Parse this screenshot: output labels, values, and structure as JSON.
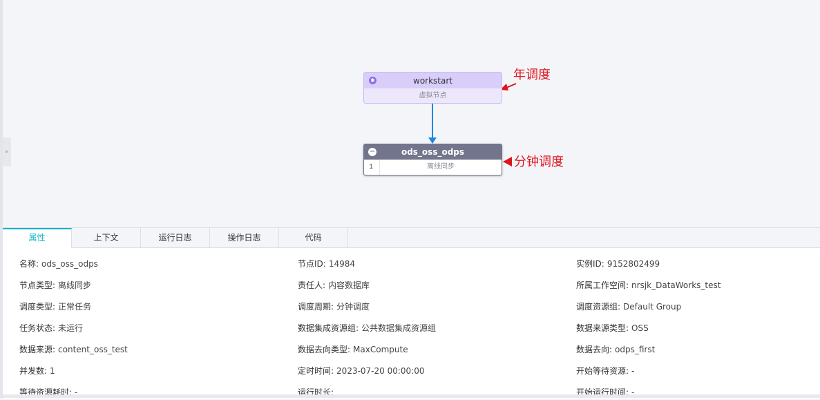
{
  "canvas": {
    "nodes": {
      "workstart": {
        "name": "workstart",
        "subtitle": "虚拟节点",
        "icon": "asterisk-icon"
      },
      "ods": {
        "name": "ods_oss_odps",
        "index": "1",
        "subtitle": "离线同步",
        "icon": "minus-circle-icon"
      }
    },
    "annotations": {
      "first": "年调度",
      "second": "分钟调度",
      "color": "#e0141e"
    },
    "collapse_glyph": "»"
  },
  "tabs": [
    {
      "label": "属性",
      "active": true
    },
    {
      "label": "上下文",
      "active": false
    },
    {
      "label": "运行日志",
      "active": false
    },
    {
      "label": "操作日志",
      "active": false
    },
    {
      "label": "代码",
      "active": false
    }
  ],
  "properties": [
    [
      {
        "label": "名称:",
        "value": "ods_oss_odps"
      },
      {
        "label": "节点ID:",
        "value": "14984"
      },
      {
        "label": "实例ID:",
        "value": "9152802499"
      }
    ],
    [
      {
        "label": "节点类型:",
        "value": "离线同步"
      },
      {
        "label": "责任人:",
        "value": "内容数据库"
      },
      {
        "label": "所属工作空间:",
        "value": "nrsjk_DataWorks_test"
      }
    ],
    [
      {
        "label": "调度类型:",
        "value": "正常任务"
      },
      {
        "label": "调度周期:",
        "value": "分钟调度"
      },
      {
        "label": "调度资源组:",
        "value": "Default Group"
      }
    ],
    [
      {
        "label": "任务状态:",
        "value": "未运行"
      },
      {
        "label": "数据集成资源组:",
        "value": "公共数据集成资源组"
      },
      {
        "label": "数据来源类型:",
        "value": "OSS"
      }
    ],
    [
      {
        "label": "数据来源:",
        "value": "content_oss_test"
      },
      {
        "label": "数据去向类型:",
        "value": "MaxCompute"
      },
      {
        "label": "数据去向:",
        "value": "odps_first"
      }
    ],
    [
      {
        "label": "并发数:",
        "value": "1"
      },
      {
        "label": "定时时间:",
        "value": "2023-07-20 00:00:00"
      },
      {
        "label": "开始等待资源:",
        "value": "-"
      }
    ],
    [
      {
        "label": "等待资源耗时:",
        "value": "-"
      },
      {
        "label": "运行时长:",
        "value": ""
      },
      {
        "label": "开始运行时间:",
        "value": "-"
      }
    ]
  ],
  "colors": {
    "accent": "#14b3c7",
    "edge": "#1f86e0",
    "virtual_node": "#d9cefa",
    "sync_node": "#72758b"
  }
}
